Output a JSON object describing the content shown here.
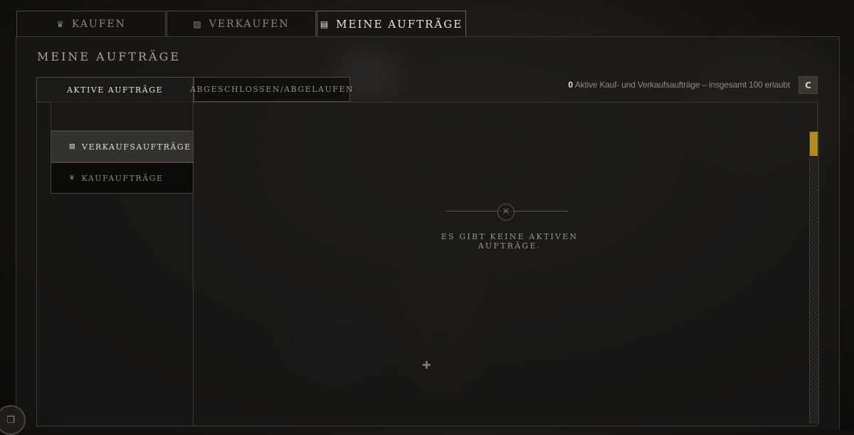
{
  "top_tabs": [
    {
      "label": "KAUFEN",
      "icon": "crown-icon",
      "active": false
    },
    {
      "label": "VERKAUFEN",
      "icon": "box-icon",
      "active": false
    },
    {
      "label": "MEINE AUFTRÄGE",
      "icon": "clipboard-icon",
      "active": true
    }
  ],
  "page": {
    "title": "MEINE AUFTRÄGE"
  },
  "sub_tabs": [
    {
      "label": "AKTIVE AUFTRÄGE",
      "active": true
    },
    {
      "label": "ABGESCHLOSSEN/ABGELAUFEN",
      "active": false
    }
  ],
  "status": {
    "count": "0",
    "text": "Aktive Kauf- und Verkaufsaufträge – insgesamt 100 erlaubt"
  },
  "sidebar": {
    "items": [
      {
        "label": "VERKAUFSAUFTRÄGE",
        "icon": "box-icon",
        "active": true
      },
      {
        "label": "KAUFAUFTRÄGE",
        "icon": "crown-icon",
        "active": false
      }
    ]
  },
  "empty_state": {
    "message": "ES GIBT KEINE AKTIVEN AUFTRÄGE.",
    "icon": "close-circle-icon"
  },
  "scroll": {
    "position": 0
  },
  "colors": {
    "accent": "#b38a26",
    "text_active": "#ece6d8",
    "text_muted": "#8e877a"
  }
}
